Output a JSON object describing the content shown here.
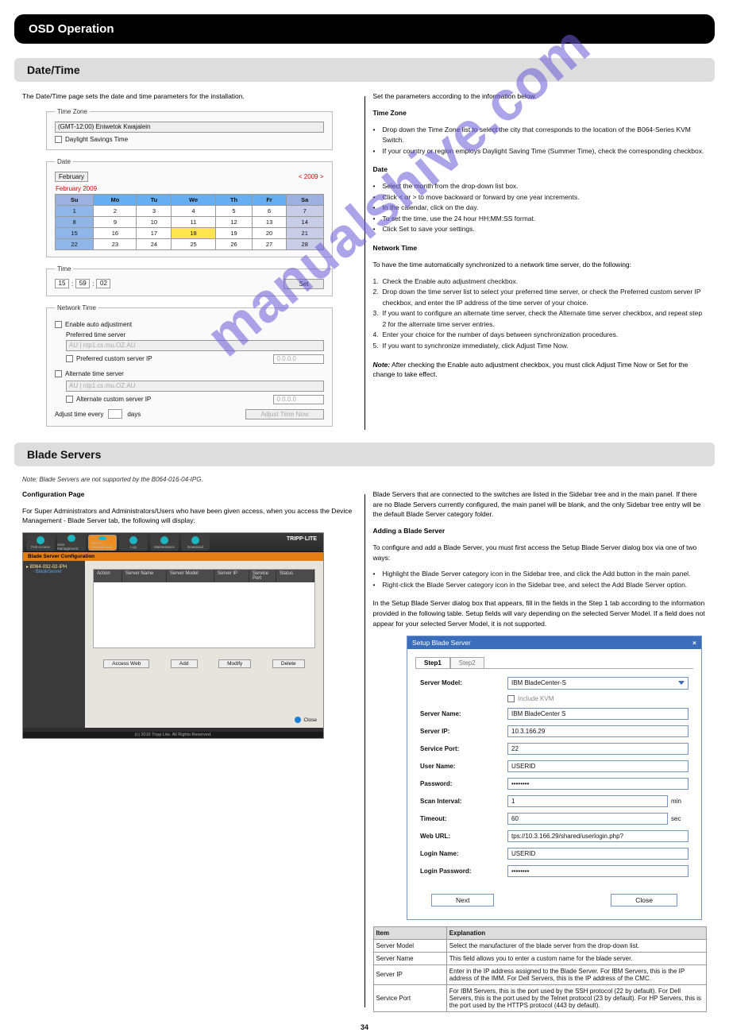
{
  "page_number": "34",
  "banner": "OSD Operation",
  "watermark": "manualshive.com",
  "section_datetime": {
    "heading": "Date/Time",
    "intro": "The Date/Time page sets the date and time parameters for the installation.",
    "tz_legend": "Time Zone",
    "tz_value": "(GMT-12:00) Eniwetok Kwajalein",
    "dst_label": "Daylight Savings Time",
    "date_legend": "Date",
    "month": "February",
    "year_nav": "<  2009  >",
    "cal_title": "February 2009",
    "days": [
      "Su",
      "Mo",
      "Tu",
      "We",
      "Th",
      "Fr",
      "Sa"
    ],
    "rows": [
      [
        "1",
        "2",
        "3",
        "4",
        "5",
        "6",
        "7"
      ],
      [
        "8",
        "9",
        "10",
        "11",
        "12",
        "13",
        "14"
      ],
      [
        "15",
        "16",
        "17",
        "18",
        "19",
        "20",
        "21"
      ],
      [
        "22",
        "23",
        "24",
        "25",
        "26",
        "27",
        "28"
      ]
    ],
    "today_cell": "18",
    "time_legend": "Time",
    "time_h": "15",
    "time_m": "59",
    "time_s": "02",
    "set_btn": "Set",
    "net_legend": "Network Time",
    "enable_auto": "Enable auto adjustment",
    "pref_server_lbl": "Preferred time server",
    "server_val": "AU | ntp1.cs.mu.OZ.AU",
    "pref_custom_lbl": "Preferred custom server IP",
    "ip_placeholder": "0.0.0.0",
    "alt_server_lbl": "Alternate time server",
    "alt_custom_lbl": "Alternate custom server IP",
    "adjust_every": "Adjust time every",
    "days_lbl": "days",
    "adjust_btn": "Adjust Time Now",
    "right": {
      "p1": "Set the parameters according to the information below.",
      "tz_h": "Time Zone",
      "tz_bullets": [
        "Drop down the Time Zone list to select the city that corresponds to the location of the B064-Series KVM Switch.",
        "If your country or region employs Daylight Saving Time (Summer Time), check the corresponding checkbox."
      ],
      "date_h": "Date",
      "date_bullets": [
        "Select the month from the drop-down list box.",
        "Click < or > to move backward or forward by one year increments.",
        "In the calendar, click on the day.",
        "To set the time, use the 24 hour HH:MM:SS format.",
        "Click Set to save your settings."
      ],
      "net_h": "Network Time",
      "net_intro": "To have the time automatically synchronized to a network time server, do the following:",
      "steps": [
        "Check the Enable auto adjustment checkbox.",
        "Drop down the time server list to select your preferred time server, or check the Preferred custom server IP checkbox, and enter the IP address of the time server of your choice.",
        "If you want to configure an alternate time server, check the Alternate time server checkbox, and repeat step 2 for the alternate time server entries.",
        "Enter your choice for the number of days between synchronization procedures.",
        "If you want to synchronize immediately, click Adjust Time Now."
      ],
      "note_lbl": "Note:",
      "note_txt": "After checking the Enable auto adjustment checkbox, you must click Adjust Time Now or Set for the change to take effect."
    }
  },
  "section_blade": {
    "heading": "Blade Servers",
    "intro": "Note: Blade Servers are not supported by the B064-016-04-IPG.",
    "config_h": "Configuration Page",
    "config_txt": "For Super Administrators and Administrators/Users who have been given access, when you access the Device Management - Blade Server tab, the following will display:",
    "app_brand": "TRIPP·LITE",
    "top_tabs": [
      "Port Access",
      "User Management",
      "Device Management",
      "Log",
      "Maintenance",
      "Download"
    ],
    "top_selected": "Device Management",
    "orange_title": "Blade Server Configuration",
    "tree_root": "B064-032-02-IPH",
    "tree_leaf": "BladeServer",
    "table_cols": [
      "Action",
      "Server Name",
      "Server Model",
      "Server IP",
      "Service Port",
      "Status"
    ],
    "btns": [
      "Access Web",
      "Add",
      "Modify",
      "Delete"
    ],
    "close": "Close",
    "footer": "(c) 2016 Tripp Lite. All Rights Reserved.",
    "right": {
      "p1": "Blade Servers that are connected to the switches are listed in the Sidebar tree and in the main panel. If there are no Blade Servers currently configured, the main panel will be blank, and the only Sidebar tree entry will be the default Blade Server category folder.",
      "add_h": "Adding a Blade Server",
      "add_txt": "To configure and add a Blade Server, you must first access the Setup Blade Server dialog box via one of two ways:",
      "add_bullets": [
        "Highlight the Blade Server category icon in the Sidebar tree, and click the Add button in the main panel.",
        "Right-click the Blade Server category icon in the Sidebar tree, and select the Add Blade Server option."
      ],
      "setup_txt": "In the Setup Blade Server dialog box that appears, fill in the fields in the Step 1 tab according to the information provided in the following table. Setup fields will vary depending on the selected Server Model. If a field does not appear for your selected Server Model, it is not supported.",
      "dlg_title": "Setup Blade Server",
      "tab1": "Step1",
      "tab2": "Step2",
      "fields": {
        "server_model_lbl": "Server Model:",
        "server_model_val": "IBM BladeCenter-S",
        "include_kvm": "Include KVM",
        "server_name_lbl": "Server Name:",
        "server_name_val": "IBM BladeCenter S",
        "server_ip_lbl": "Server IP:",
        "server_ip_val": "10.3.166.29",
        "service_port_lbl": "Service Port:",
        "service_port_val": "22",
        "user_lbl": "User Name:",
        "user_val": "USERID",
        "pass_lbl": "Password:",
        "pass_val": "••••••••",
        "scan_lbl": "Scan Interval:",
        "scan_val": "1",
        "scan_unit": "min",
        "timeout_lbl": "Timeout:",
        "timeout_val": "60",
        "timeout_unit": "sec",
        "weburl_lbl": "Web URL:",
        "weburl_val": "tps://10.3.166.29/shared/userlogin.php?",
        "login_lbl": "Login Name:",
        "login_val": "USERID",
        "loginpw_lbl": "Login Password:",
        "loginpw_val": "••••••••"
      },
      "next_btn": "Next",
      "close_btn": "Close",
      "tbl_rows": [
        [
          "Server Model",
          "Select the manufacturer of the blade server from the drop-down list."
        ],
        [
          "Server Name",
          "This field allows you to enter a custom name for the blade server."
        ],
        [
          "Server IP",
          "Enter in the IP address assigned to the Blade Server. For IBM Servers, this is the IP address of the IMM. For Dell Servers, this is the IP address of the CMC."
        ],
        [
          "Service Port",
          "For IBM Servers, this is the port used by the SSH protocol (22 by default). For Dell Servers, this is the port used by the Telnet protocol (23 by default). For HP Servers, this is the port used by the HTTPS protocol (443 by default)."
        ]
      ],
      "tbl_h1": "Item",
      "tbl_h2": "Explanation"
    }
  }
}
